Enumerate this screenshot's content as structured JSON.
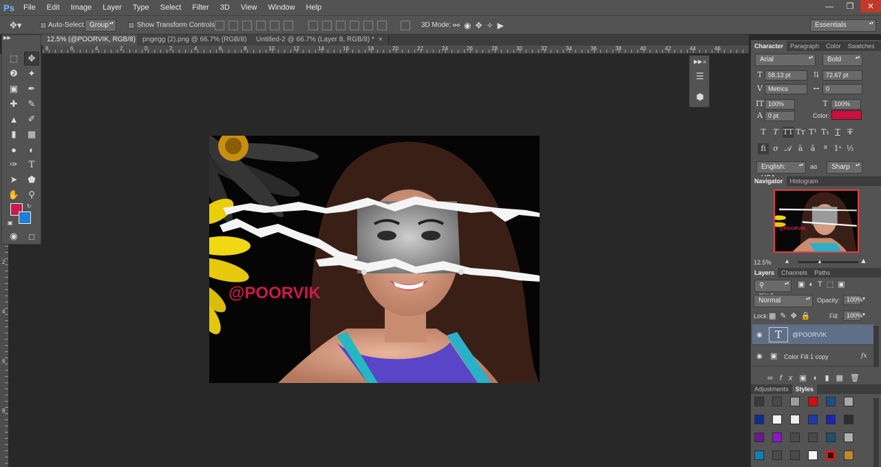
{
  "app": {
    "logo": "Ps"
  },
  "menu": [
    "File",
    "Edit",
    "Image",
    "Layer",
    "Type",
    "Select",
    "Filter",
    "3D",
    "View",
    "Window",
    "Help"
  ],
  "window_controls": {
    "minimize": "—",
    "restore": "❐",
    "close": "✕"
  },
  "options": {
    "auto_select_label": "Auto-Select:",
    "auto_select_value": "Group",
    "show_transform_label": "Show Transform Controls",
    "mode_3d_label": "3D Mode:",
    "workspace": "Essentials"
  },
  "tabs": [
    {
      "label": "12.5% (@POORVIK, RGB/8) *",
      "active": true
    },
    {
      "label": "pngegg (2).png @ 66.7% (RGB/8)",
      "active": false
    },
    {
      "label": "Untitled-2 @ 66.7% (Layer 8, RGB/8) *",
      "active": false
    }
  ],
  "ruler": {
    "h": [
      "8",
      "6",
      "4",
      "2",
      "0",
      "2",
      "4",
      "6",
      "8",
      "10",
      "12",
      "14",
      "16",
      "18",
      "20",
      "22",
      "24",
      "26",
      "28",
      "30",
      "32",
      "34",
      "36",
      "38",
      "40",
      "42",
      "44",
      "46"
    ],
    "v": [
      "6",
      "8",
      "1",
      "0",
      "2",
      "4",
      "6",
      "8"
    ]
  },
  "canvas": {
    "watermark": "@POORVIK",
    "watermark_color": "#cc1a4a"
  },
  "character": {
    "tabs": [
      "Character",
      "Paragraph",
      "Color",
      "Swatches"
    ],
    "font_family": "Arial",
    "font_style": "Bold",
    "font_size": "58.13 pt",
    "leading": "72.67 pt",
    "kerning": "Metrics",
    "tracking": "0",
    "vscale": "100%",
    "hscale": "100%",
    "baseline": "0 pt",
    "color_label": "Color:",
    "color_value": "#c9103f",
    "language": "English: USA",
    "aa_label": "aɑ",
    "antialias": "Sharp"
  },
  "navigator": {
    "tabs": [
      "Navigator",
      "Histogram"
    ],
    "zoom": "12.5%",
    "thumb_text": "@POORVIK"
  },
  "layers": {
    "tabs": [
      "Layers",
      "Channels",
      "Paths"
    ],
    "kind": "Kind",
    "blend": "Normal",
    "opacity_label": "Opacity:",
    "opacity": "100%",
    "lock_label": "Lock:",
    "fill_label": "Fill:",
    "fill": "100%",
    "items": [
      {
        "name": "@POORVIK",
        "selected": true,
        "type": "text"
      },
      {
        "name": "Color Fill 1 copy",
        "selected": false,
        "type": "fill"
      }
    ]
  },
  "styles": {
    "tabs": [
      "Adjustments",
      "Styles"
    ],
    "swatches": [
      "#3a3a3a",
      "#4a4a4a",
      "#9e9e9e",
      "#d40d0d",
      "#1d4e8a",
      "#a8a8a8",
      "#0e2e8e",
      "#f2f2f2",
      "#ececec",
      "#1e3aa8",
      "#1a24b8",
      "#2f2f2f",
      "#6a1a8a",
      "#8a18c8",
      "#4a4a4a",
      "#4a4a4a",
      "#1f4f6a",
      "#b0b0b0",
      "#0e7fb8",
      "#4a4a4a",
      "#4a4a4a",
      "#f5f5f5",
      "#e01818",
      "#c08a2a"
    ]
  }
}
